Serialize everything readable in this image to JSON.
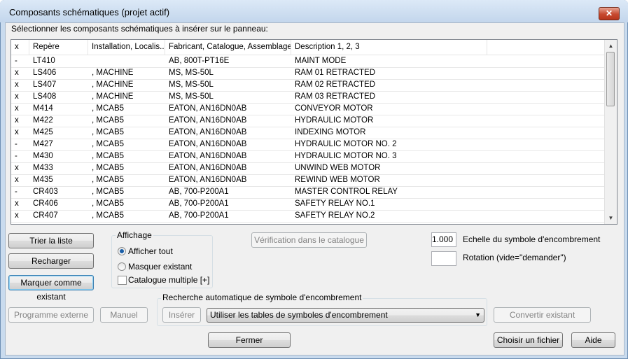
{
  "window": {
    "title": "Composants schématiques (projet actif)",
    "close_symbol": "✕"
  },
  "prompt": "Sélectionner les composants schématiques à insérer sur le panneau:",
  "list": {
    "columns": [
      "x",
      "Repère",
      "Installation, Localis...",
      "Fabricant, Catalogue, Assemblage",
      "Description 1, 2, 3",
      ""
    ],
    "rows": [
      [
        "-",
        "LT410",
        "",
        "AB, 800T-PT16E",
        "MAINT MODE"
      ],
      [
        "x",
        "LS406",
        ", MACHINE",
        "MS, MS-50L",
        "RAM 01 RETRACTED"
      ],
      [
        "x",
        "LS407",
        ", MACHINE",
        "MS, MS-50L",
        "RAM 02 RETRACTED"
      ],
      [
        "x",
        "LS408",
        ", MACHINE",
        "MS, MS-50L",
        "RAM 03 RETRACTED"
      ],
      [
        "x",
        "M414",
        ", MCAB5",
        "EATON, AN16DN0AB",
        "CONVEYOR MOTOR"
      ],
      [
        "x",
        "M422",
        ", MCAB5",
        "EATON, AN16DN0AB",
        "HYDRAULIC MOTOR"
      ],
      [
        "x",
        "M425",
        ", MCAB5",
        "EATON, AN16DN0AB",
        "INDEXING MOTOR"
      ],
      [
        "-",
        "M427",
        ", MCAB5",
        "EATON, AN16DN0AB",
        "HYDRAULIC MOTOR NO. 2"
      ],
      [
        "-",
        "M430",
        ", MCAB5",
        "EATON, AN16DN0AB",
        "HYDRAULIC MOTOR NO. 3"
      ],
      [
        "x",
        "M433",
        ", MCAB5",
        "EATON, AN16DN0AB",
        "UNWIND WEB MOTOR"
      ],
      [
        "x",
        "M435",
        ", MCAB5",
        "EATON, AN16DN0AB",
        "REWIND WEB MOTOR"
      ],
      [
        "-",
        "CR403",
        ", MCAB5",
        "AB, 700-P200A1",
        "MASTER CONTROL RELAY"
      ],
      [
        "x",
        "CR406",
        ", MCAB5",
        "AB, 700-P200A1",
        "SAFETY RELAY NO.1"
      ],
      [
        "x",
        "CR407",
        ", MCAB5",
        "AB, 700-P200A1",
        "SAFETY RELAY NO.2"
      ]
    ],
    "scroll_up": "▲",
    "scroll_down": "▼"
  },
  "buttons": {
    "sort": "Trier la liste",
    "reload": "Recharger",
    "mark_existing": "Marquer comme existant",
    "catalog_check": "Vérification dans le catalogue",
    "external_program": "Programme externe",
    "manual": "Manuel",
    "insert": "Insérer",
    "convert_existing": "Convertir existant",
    "close": "Fermer",
    "choose_file": "Choisir un fichier",
    "help": "Aide"
  },
  "display_group": {
    "title": "Affichage",
    "show_all": "Afficher tout",
    "hide_existing": "Masquer existant",
    "multi_catalog": "Catalogue multiple [+]",
    "selected": "show_all"
  },
  "scale": {
    "value": "1.000",
    "label": "Echelle du symbole d'encombrement"
  },
  "rotation": {
    "value": "",
    "label": "Rotation (vide=\"demander\")"
  },
  "footprint_group": {
    "title": "Recherche automatique de symbole d'encombrement",
    "combo_value": "Utiliser les tables de symboles d'encombrement",
    "combo_arrow": "▼"
  }
}
